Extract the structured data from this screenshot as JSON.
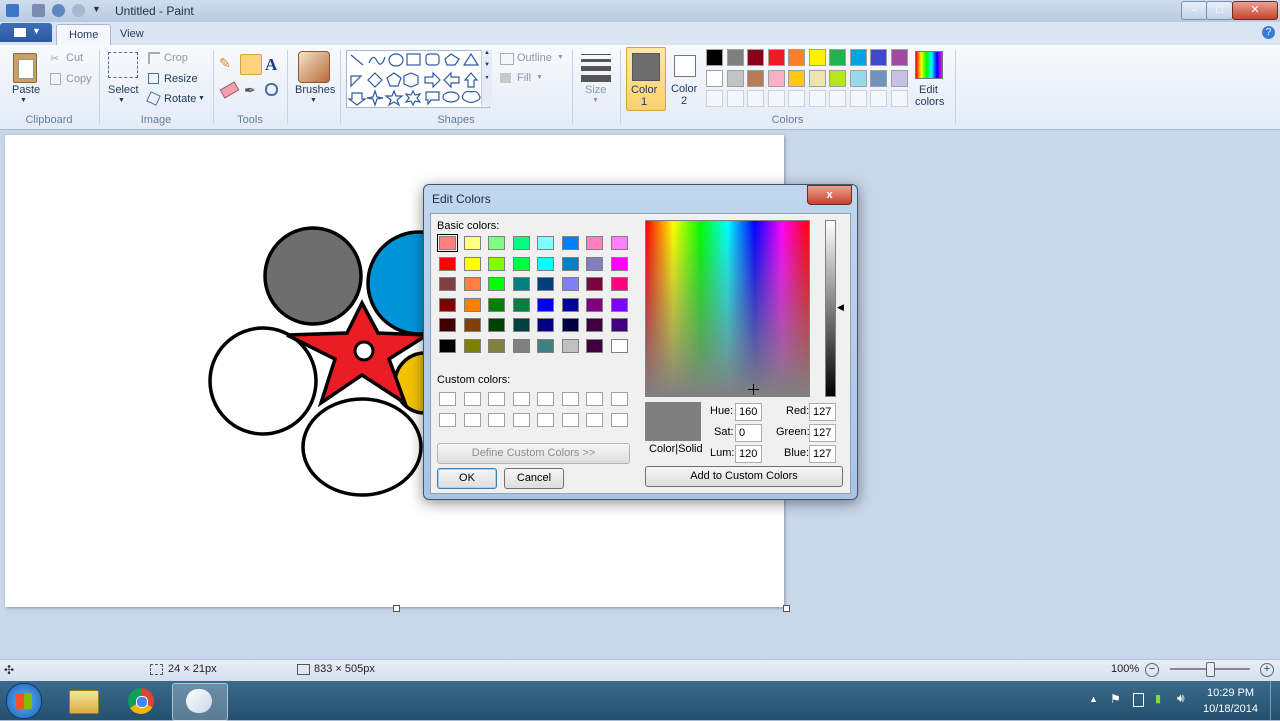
{
  "window": {
    "title": "Untitled - Paint"
  },
  "tabs": {
    "home": "Home",
    "view": "View"
  },
  "clipboard": {
    "paste": "Paste",
    "cut": "Cut",
    "copy": "Copy",
    "label": "Clipboard"
  },
  "image": {
    "select": "Select",
    "crop": "Crop",
    "resize": "Resize",
    "rotate": "Rotate",
    "label": "Image"
  },
  "tools": {
    "label": "Tools"
  },
  "brushes": {
    "label": "Brushes"
  },
  "shapes": {
    "outline": "Outline",
    "fill": "Fill",
    "label": "Shapes"
  },
  "size": {
    "label": "Size"
  },
  "colors": {
    "color1": "Color",
    "color1_num": "1",
    "color2": "Color",
    "color2_num": "2",
    "edit": "Edit",
    "edit2": "colors",
    "label": "Colors",
    "color1_value": "#6e6e6e",
    "row1": [
      "#000000",
      "#7f7f7f",
      "#880015",
      "#ed1c24",
      "#ff7f27",
      "#fff200",
      "#22b14c",
      "#00a2e8",
      "#3f48cc",
      "#a349a4"
    ],
    "row2": [
      "#ffffff",
      "#c3c3c3",
      "#b97a57",
      "#ffaec9",
      "#ffc90e",
      "#efe4b0",
      "#b5e61d",
      "#99d9ea",
      "#7092be",
      "#c8bfe7"
    ]
  },
  "status": {
    "selection": "24 × 21px",
    "size": "833 × 505px",
    "zoom": "100%"
  },
  "taskbar": {
    "time": "10:29 PM",
    "date": "10/18/2014"
  },
  "dialog": {
    "title": "Edit Colors",
    "close": "x",
    "basic_label": "Basic colors:",
    "custom_label": "Custom colors:",
    "define_btn": "Define Custom Colors >>",
    "ok": "OK",
    "cancel": "Cancel",
    "colorsolid": "Color|Solid",
    "hue_label": "Hue:",
    "hue": "160",
    "sat_label": "Sat:",
    "sat": "0",
    "lum_label": "Lum:",
    "lum": "120",
    "red_label": "Red:",
    "red": "127",
    "green_label": "Green:",
    "green": "127",
    "blue_label": "Blue:",
    "blue": "127",
    "add_btn": "Add to Custom Colors",
    "basic_colors": [
      [
        "#ff8080",
        "#ffff80",
        "#80ff80",
        "#00ff80",
        "#80ffff",
        "#0080ff",
        "#ff80c0",
        "#ff80ff"
      ],
      [
        "#ff0000",
        "#ffff00",
        "#80ff00",
        "#00ff40",
        "#00ffff",
        "#0080c0",
        "#8080c0",
        "#ff00ff"
      ],
      [
        "#804040",
        "#ff8040",
        "#00ff00",
        "#008080",
        "#004080",
        "#8080ff",
        "#800040",
        "#ff0080"
      ],
      [
        "#800000",
        "#ff8000",
        "#008000",
        "#008040",
        "#0000ff",
        "#0000a0",
        "#800080",
        "#8000ff"
      ],
      [
        "#400000",
        "#804000",
        "#004000",
        "#004040",
        "#000080",
        "#000040",
        "#400040",
        "#400080"
      ],
      [
        "#000000",
        "#808000",
        "#808040",
        "#808080",
        "#408080",
        "#c0c0c0",
        "#400040",
        "#ffffff"
      ]
    ],
    "current_color": "#7f7f7f"
  }
}
